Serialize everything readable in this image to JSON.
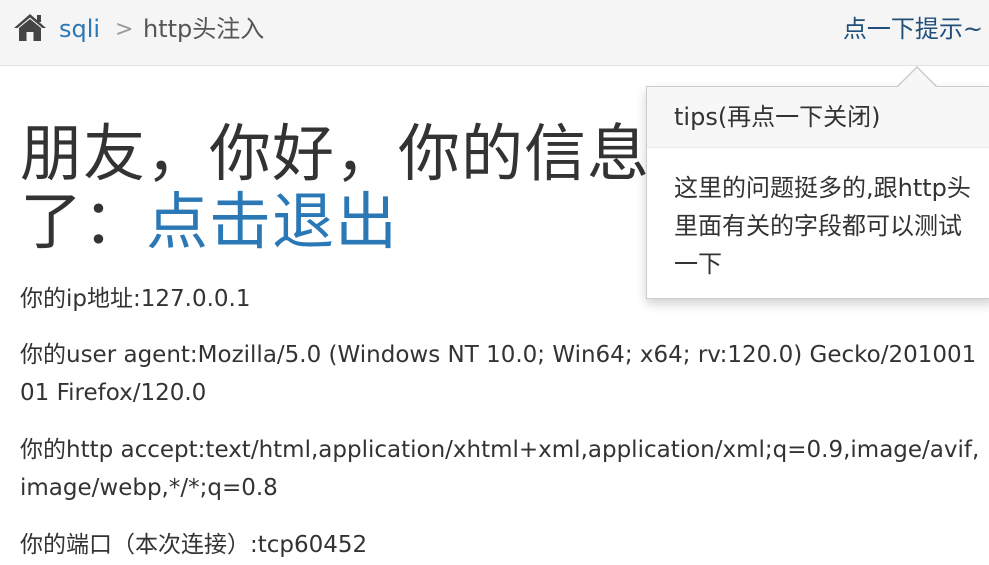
{
  "breadcrumb": {
    "home_icon": "home-icon",
    "link": "sqli",
    "separator": ">",
    "current": "http头注入"
  },
  "hint_link": "点一下提示~",
  "popover": {
    "title": "tips(再点一下关闭)",
    "content": "这里的问题挺多的,跟http头里面有关的字段都可以测试一下"
  },
  "main": {
    "greeting_prefix": "朋友，你好，你的信息已经被记录了：",
    "logout_link": "点击退出",
    "ip_line": "你的ip地址:127.0.0.1",
    "user_agent_line": "你的user agent:Mozilla/5.0 (Windows NT 10.0; Win64; x64; rv:120.0) Gecko/20100101 Firefox/120.0",
    "accept_line": "你的http accept:text/html,application/xhtml+xml,application/xml;q=0.9,image/avif,image/webp,*/*;q=0.8",
    "port_line": "你的端口（本次连接）:tcp60452"
  },
  "colors": {
    "link": "#2a78b5",
    "hint_link": "#20507a",
    "text": "#333333",
    "bar_bg": "#f5f5f5"
  }
}
